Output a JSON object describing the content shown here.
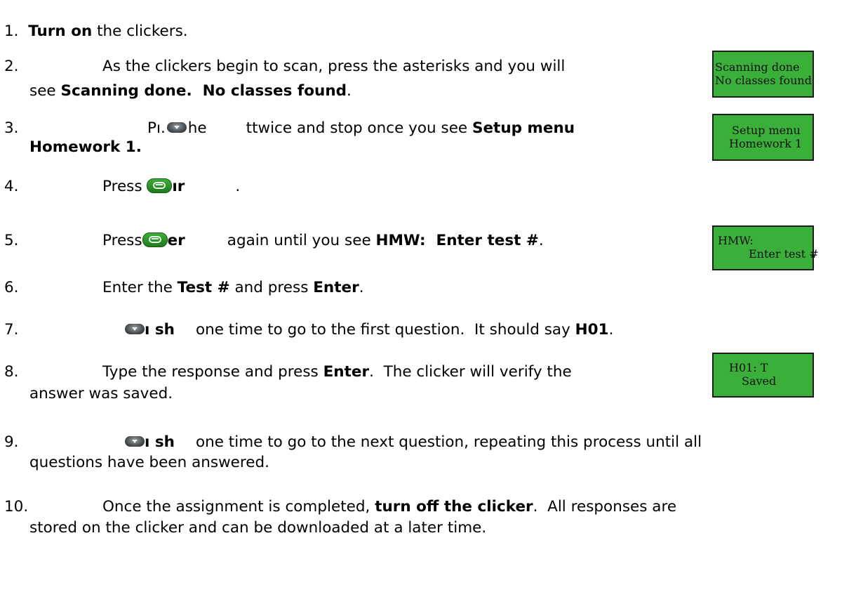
{
  "steps": [
    {
      "num": "1.",
      "bold": "Turn on",
      "text": " the clickers."
    },
    {
      "num": "2.",
      "line1": "As the clickers begin to scan, press the asterisks and you will",
      "line2_pre": "see ",
      "line2_bold": "Scanning done.  No classes found",
      "line2_post": "."
    },
    {
      "num": "3.",
      "pre": "Pı.",
      "mid": "he",
      "post": "ttwice and stop once you see ",
      "bold1": "Setup menu",
      "bold2": "Homework 1."
    },
    {
      "num": "4.",
      "pre": "Press ",
      "bold": "ır",
      "post": "."
    },
    {
      "num": "5.",
      "pre": "Press",
      "bold": "er",
      "mid": "again until you see ",
      "bold2": "HMW:  Enter test #",
      "post": "."
    },
    {
      "num": "6.",
      "pre": "Enter the ",
      "bold1": "Test #",
      "mid": " and press ",
      "bold2": "Enter",
      "post": "."
    },
    {
      "num": "7.",
      "bold": "ı sh",
      "text": "one time to go to the first question.  It should say ",
      "bold2": "H01",
      "post": "."
    },
    {
      "num": "8.",
      "pre": "Type the response and press ",
      "bold": "Enter",
      "post": ".  The clicker will verify the",
      "line2": "answer was saved."
    },
    {
      "num": "9.",
      "bold": "ı sh",
      "text": "one time to go to the next question, repeating this process until all",
      "line2": "questions have been answered."
    },
    {
      "num": "10.",
      "pre": "Once the assignment is completed, ",
      "bold": "turn off the clicker",
      "post": ".  All responses are",
      "line2": "stored on the clicker and can be downloaded at a later time."
    }
  ],
  "screens": [
    {
      "line1": "Scanning done",
      "line2": "No classes found"
    },
    {
      "line1": "Setup menu",
      "line2": "Homework 1"
    },
    {
      "line1": "HMW:",
      "line2": "Enter test #"
    },
    {
      "line1": "H01: T",
      "line2": "Saved"
    }
  ],
  "colors": {
    "lcd_background": "#3ab03a",
    "enter_button": "#2f9a2b",
    "scroll_button": "#5a6066"
  },
  "icons": {
    "enter_button": "enter-arrow-icon",
    "scroll_button": "scroll-down-icon"
  }
}
